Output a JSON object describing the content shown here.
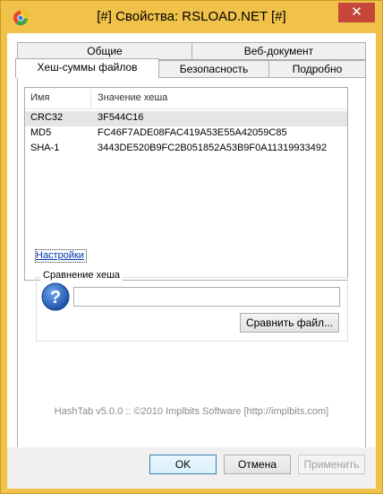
{
  "window": {
    "title": "[#] Свойства: RSLOAD.NET [#]",
    "close_glyph": "✕"
  },
  "tabs": {
    "row1": [
      {
        "label": "Общие"
      },
      {
        "label": "Веб-документ"
      }
    ],
    "row2": [
      {
        "label": "Хеш-суммы файлов",
        "active": true
      },
      {
        "label": "Безопасность"
      },
      {
        "label": "Подробно"
      }
    ]
  },
  "hash_list": {
    "columns": [
      "Имя",
      "Значение хеша"
    ],
    "rows": [
      {
        "name": "CRC32",
        "value": "3F544C16",
        "selected": true
      },
      {
        "name": "MD5",
        "value": "FC46F7ADE08FAC419A53E55A42059C85"
      },
      {
        "name": "SHA-1",
        "value": "3443DE520B9FC2B051852A53B9F0A11319933492"
      }
    ]
  },
  "settings_link": "Настройки",
  "compare": {
    "group_label": "Сравнение хеша",
    "input_value": "",
    "compare_button": "Сравнить файл..."
  },
  "footer": "HashTab v5.0.0 :: ©2010 Implbits Software [http://implbits.com]",
  "buttons": {
    "ok": "OK",
    "cancel": "Отмена",
    "apply": "Применить"
  },
  "colors": {
    "frame": "#f0c24a",
    "close": "#c7463a",
    "link": "#0033aa",
    "selection": "#e5e5e5"
  }
}
